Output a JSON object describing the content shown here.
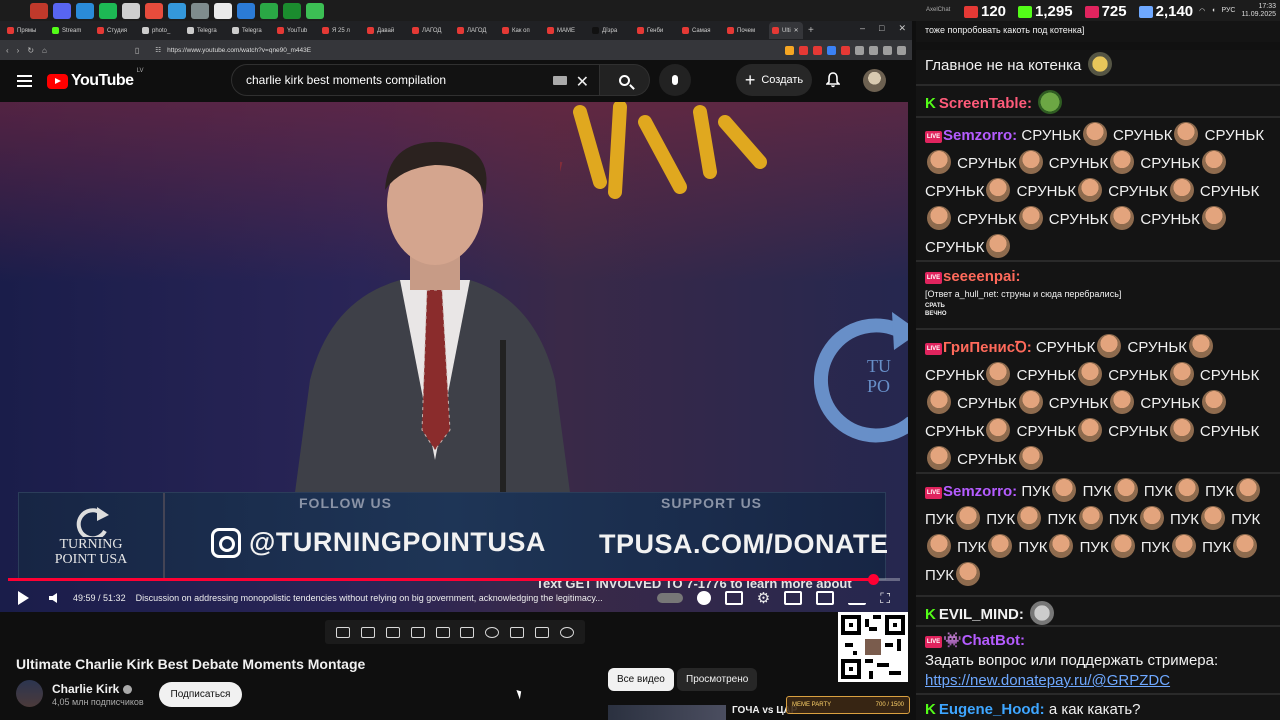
{
  "taskbar": {
    "icons": [
      "#1c1c1c",
      "#c0392b",
      "#5865f2",
      "#2a8bd8",
      "#1db954",
      "#cfcfcf",
      "#e74c3c",
      "#3498db",
      "#7f8c8d",
      "#eaeaea",
      "#2b7bd6",
      "#2aa845",
      "#1b8c2e",
      "#3cbf54"
    ],
    "tray_lang": "РУС",
    "time": "17:33",
    "date": "11.09.2025"
  },
  "browser": {
    "tabs": [
      {
        "label": "Прямы",
        "color": "#e53935"
      },
      {
        "label": "Stream",
        "color": "#53fc18"
      },
      {
        "label": "Студия",
        "color": "#e53935"
      },
      {
        "label": "photo_",
        "color": "#cccccc"
      },
      {
        "label": "Telegra",
        "color": "#cccccc"
      },
      {
        "label": "Telegra",
        "color": "#cccccc"
      },
      {
        "label": "YouTub",
        "color": "#e53935"
      },
      {
        "label": "Я 25 л",
        "color": "#e53935"
      },
      {
        "label": "Давай",
        "color": "#e53935"
      },
      {
        "label": "ЛАГОД",
        "color": "#e53935"
      },
      {
        "label": "ЛАГОД",
        "color": "#e53935"
      },
      {
        "label": "Как оп",
        "color": "#e53935"
      },
      {
        "label": "MAME",
        "color": "#e53935"
      },
      {
        "label": "Дїзра",
        "color": "#111111"
      },
      {
        "label": "Генби",
        "color": "#e53935"
      },
      {
        "label": "Самая",
        "color": "#e53935"
      },
      {
        "label": "Почем",
        "color": "#e53935"
      },
      {
        "label": "Ulti",
        "color": "#e53935",
        "active": true
      }
    ],
    "url": "https://www.youtube.com/watch?v=qne90_m443E",
    "ext_colors": [
      "#f5a623",
      "#e53935",
      "#e53935",
      "#3b82f6",
      "#e53935",
      "#9e9e9e",
      "#9e9e9e",
      "#9e9e9e",
      "#9e9e9e"
    ]
  },
  "youtube": {
    "logo_text": "YouTube",
    "region": "LV",
    "search_value": "charlie kirk best moments compilation",
    "create_label": "Создать"
  },
  "video": {
    "banner": {
      "logo_line1": "TURNING",
      "logo_line2": "POINT USA",
      "follow": "FOLLOW US",
      "support": "SUPPORT US",
      "instagram": "@TURNINGPOINTUSA",
      "donate": "TPUSA.COM/DONATE"
    },
    "ticker": "Text GET INVOLVED TO 7-1776 to learn more about",
    "time_current": "49:59",
    "time_total": "51:32",
    "chapter": "Discussion on addressing monopolistic tendencies without relying on big government, acknowledging the legitimacy...",
    "progress": 0.97,
    "title": "Ultimate Charlie Kirk Best Debate Moments Montage",
    "channel": "Charlie Kirk",
    "subscribers": "4,05 млн подписчиков",
    "subscribe_label": "Подписаться"
  },
  "chips": {
    "all": "Все видео",
    "watched": "Просмотрено"
  },
  "recommended": {
    "title": "ГОЧА vs ЦАР"
  },
  "meme_party": {
    "label": "MEME PARTY",
    "count": "700 / 1500"
  },
  "chat": {
    "app": "AxelChat",
    "stats": [
      {
        "value": "120",
        "color": "#e53935"
      },
      {
        "value": "1,295",
        "color": "#53fc18"
      },
      {
        "value": "725",
        "color": "#e0245e"
      },
      {
        "value": "2,140",
        "color": "#6ea8ff"
      }
    ],
    "header_fragment": "тоже попробовать какоть под котенка]",
    "line1": "Главное не на котенка",
    "m1_name": "ScreenTable:",
    "m2_name": "Semzorro:",
    "srunk": "СРУНЬК",
    "m3_name": "seeeenpai:",
    "m3_reply": "[Ответ a_hull_net: струны и сюда перебрались]",
    "m3_sticker": "СРАТЬ ВЕЧНО",
    "m4_name": "ГриПенисꝹ:",
    "m5_name": "Semzorro:",
    "puk": "ПУК",
    "m6_name": "EVIL_MIND:",
    "m7_name": "ChatBot:",
    "m7_text": "Задать вопрос или поддержать стримера:",
    "m7_link": "https://new.donatepay.ru/@GRPZDC",
    "m8_name": "Eugene_Hood:",
    "m8_text": "а как какать?",
    "colors": {
      "kick": "#53fc18",
      "vk": "#e0245e",
      "semzorro": "#b55cff",
      "screentable": "#ff5b7a",
      "seeeenpai": "#ff6a5b",
      "gripenis": "#ff6a5b",
      "evil": "#ffffff",
      "chatbot": "#b55cff",
      "eugene": "#3ea6ff"
    }
  }
}
